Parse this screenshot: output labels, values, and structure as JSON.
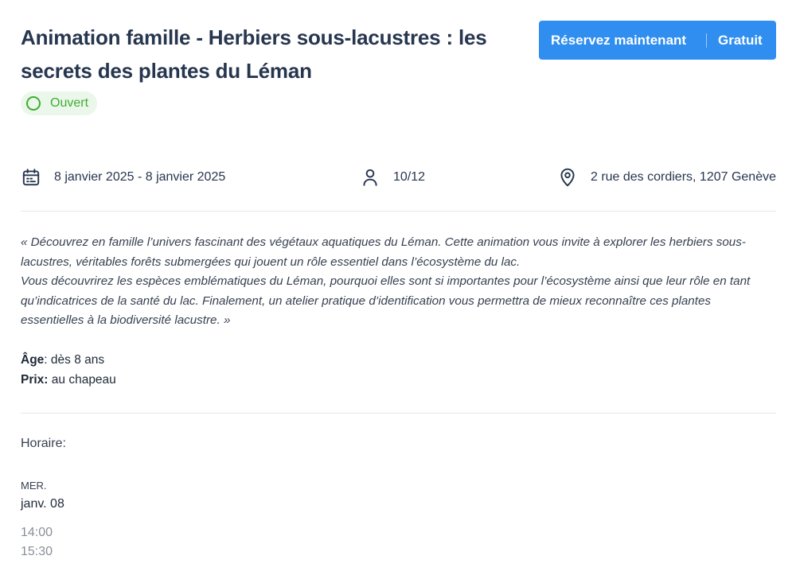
{
  "event": {
    "title": "Animation famille - Herbiers sous-lacustres : les secrets des plantes du Léman",
    "status": "Ouvert"
  },
  "booking": {
    "button_label": "Réservez maintenant",
    "price": "Gratuit"
  },
  "meta": {
    "dates": "8 janvier 2025 - 8 janvier 2025",
    "seats": "10/12",
    "address": "2 rue des cordiers, 1207 Genève"
  },
  "description": {
    "paragraph1": "« Découvrez en famille l’univers fascinant des végétaux aquatiques du Léman. Cette animation vous invite à explorer les herbiers sous-lacustres, véritables forêts submergées qui jouent un rôle essentiel dans l’écosystème du lac.",
    "paragraph2": "Vous découvrirez les espèces emblématiques du Léman, pourquoi elles sont si importantes pour l’écosystème ainsi que leur rôle en tant qu’indicatrices de la santé du lac. Finalement, un atelier pratique d’identification vous permettra de mieux reconnaître ces plantes essentielles à la biodiversité lacustre. »"
  },
  "details": {
    "age_label": "Âge",
    "age_value": ": dès 8 ans",
    "price_label": "Prix:",
    "price_value": " au chapeau"
  },
  "schedule": {
    "label": "Horaire:",
    "day_abbr": "MER.",
    "date": "janv. 08",
    "start": "14:00",
    "end": "15:30"
  },
  "icons": {
    "date": "calendar-icon",
    "seats": "person-icon",
    "place": "location-pin-icon",
    "status": "circle-icon"
  },
  "colors": {
    "accent": "#2f8ef0",
    "status": "#3fad33",
    "title": "#27364f"
  }
}
